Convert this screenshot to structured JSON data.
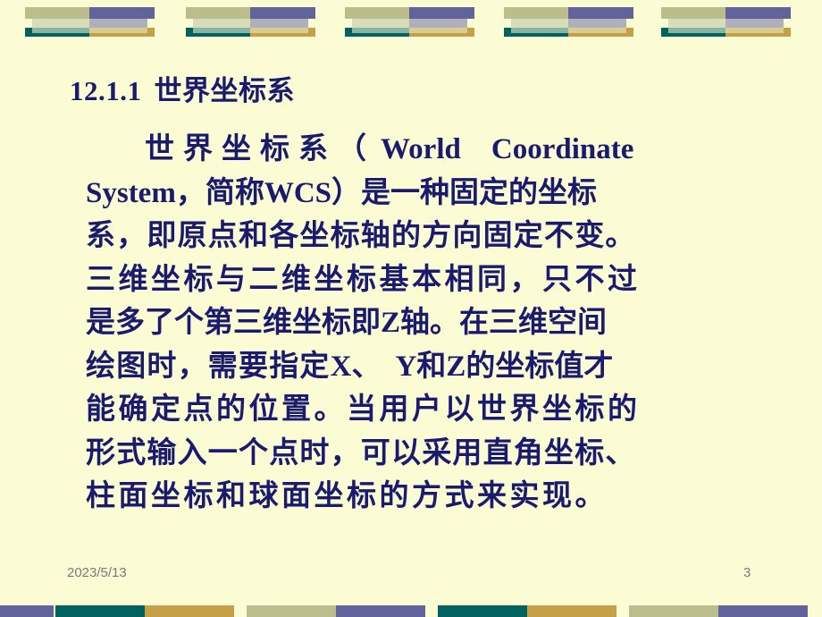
{
  "slide": {
    "background_color": "#fbfbd4",
    "text_color": "#1a1a6e",
    "heading": {
      "number": "12.1.1",
      "title": "世界坐标系"
    },
    "body_lines": [
      "世界坐标系（World Coordinate",
      "System，简称WCS）是一种固定的坐标",
      "系，即原点和各坐标轴的方向固定不变。",
      "三维坐标与二维坐标基本相同，只不过",
      "是多了个第三维坐标即Z轴。在三维空间",
      "绘图时，需要指定X、Y和Z的坐标值才",
      "能确定点的位置。当用户以世界坐标的",
      "形式输入一个点时，可以采用直角坐标、",
      "柱面坐标和球面坐标的方式来实现。"
    ],
    "body_segments": {
      "l1_a": "世界坐标系",
      "l1_b": "（",
      "l1_c": "World",
      "l1_d": "Coordinate",
      "l2_a": "System",
      "l2_b": "，简称",
      "l2_c": "WCS",
      "l2_d": "）是一种固定的坐标",
      "l3": "系，即原点和各坐标轴的方向固定不变。",
      "l4": "三维坐标与二维坐标基本相同，只不过",
      "l5_a": "是多了个第三维坐标即",
      "l5_b": "Z",
      "l5_c": "轴。在三维空间",
      "l6_a": "绘图时，需要指定",
      "l6_b": "X",
      "l6_c": "、",
      "l6_d": "Y",
      "l6_e": "和",
      "l6_f": "Z",
      "l6_g": "的坐标值才",
      "l7": "能确定点的位置。当用户以世界坐标的",
      "l8": "形式输入一个点时，可以采用直角坐标、",
      "l9": "柱面坐标和球面坐标的方式来实现。"
    }
  },
  "footer": {
    "date": "2023/5/13",
    "page_number": "3",
    "text_color": "#7b7b7b"
  },
  "decoration": {
    "top_band": {
      "colors": {
        "khaki": "#bcbd8c",
        "pale_khaki": "#d9dcb8",
        "teal": "#016260",
        "sea_green": "#8ab5a2",
        "slate_purple": "#63639b",
        "light_purple_gray": "#b0b0bd",
        "gold": "#c6a046",
        "pale_gold": "#ddcc92"
      },
      "unit_count": 5
    },
    "bottom_band": {
      "unit_count": 5,
      "pairs": [
        [
          "#016260",
          "#c6a046"
        ],
        [
          "#bcbd8c",
          "#63639b"
        ],
        [
          "#016260",
          "#c6a046"
        ],
        [
          "#bcbd8c",
          "#63639b"
        ],
        [
          "#016260",
          "#c6a046"
        ]
      ]
    }
  }
}
